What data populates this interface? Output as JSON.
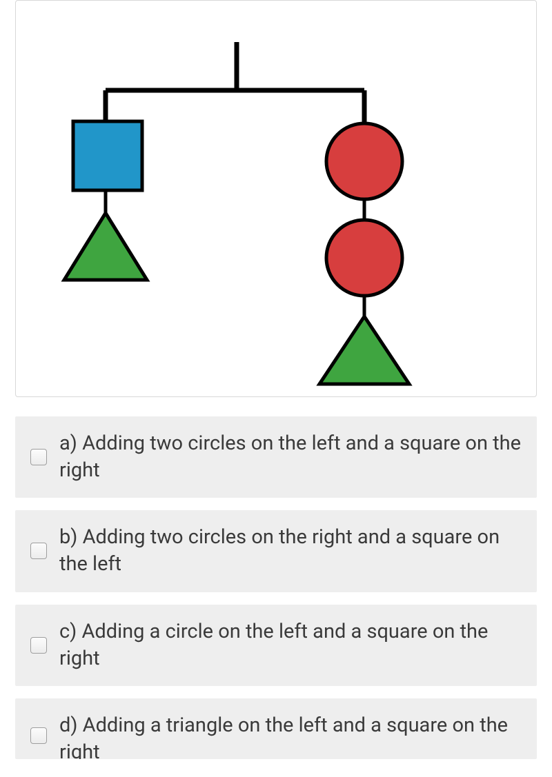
{
  "options": {
    "a": "a) Adding two circles on the left and a square on the right",
    "b": "b) Adding two circles on the right and a square on the left",
    "c": "c) Adding a circle on the left and a square on the right",
    "d": "d) Adding a triangle on the left and a square on the right"
  },
  "colors": {
    "square": "#2196c9",
    "circle": "#d73e3e",
    "triangle": "#3fa540"
  }
}
